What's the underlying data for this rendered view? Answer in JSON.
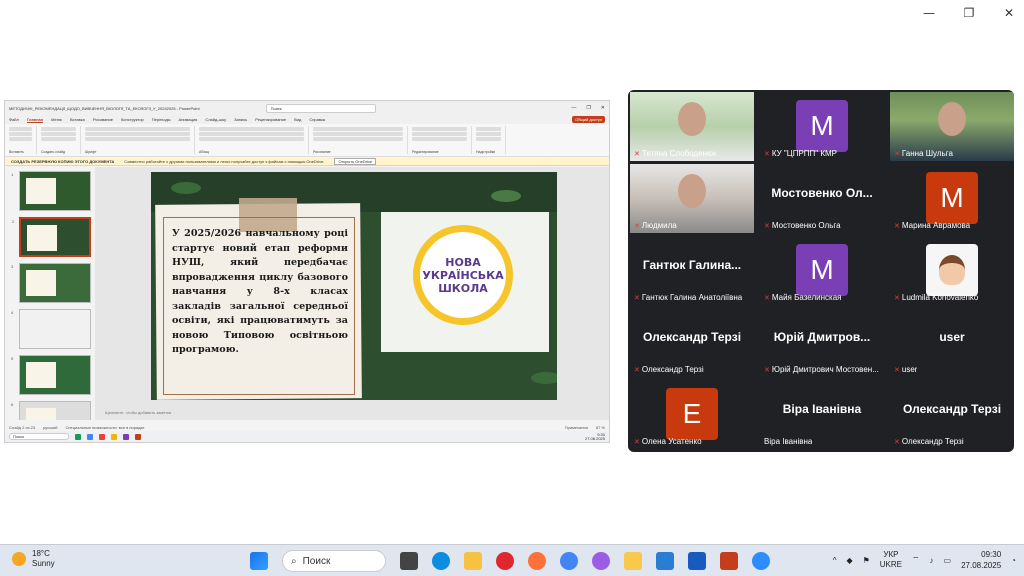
{
  "window": {
    "minimize": "—",
    "restore": "❐",
    "close": "✕"
  },
  "pp": {
    "title": "МЕТОДИЧНІ_РЕКОМЕНДАЦІЇ_ЩОДО_ВИВЧЕННЯ_ВІОЛОГІЇ_ТА_ЕКОЛОГІЇ_У_20242025 - PowerPoint",
    "search": "Поиск",
    "menu": [
      "Файл",
      "Главная",
      "Меню",
      "Вставка",
      "Рисование",
      "Конструктор",
      "Переходы",
      "Анимация",
      "Слайд-шоу",
      "Запись",
      "Рецензирование",
      "Вид",
      "Справка"
    ],
    "share_label": "Общий доступ",
    "ribbon_groups": [
      "Вставить",
      "Создать слайд",
      "Шрифт",
      "Абзац",
      "Рисование",
      "Редактирование",
      "Надстройки"
    ],
    "notice_bold": "СОЗДАТЬ РЕЗЕРВНУЮ КОПИЮ ЭТОГО ДОКУМЕНТА",
    "notice_text": "Совместно работайте с другими пользователями и легко получайте доступ к файлам с помощью OneDrive.",
    "notice_btn": "Открыть OneDrive",
    "slide_numbers": [
      "1",
      "2",
      "3",
      "4",
      "5",
      "6"
    ],
    "slide_text": "У 2025/2026 навчальному році стартує новий етап реформи НУШ, який передбачає впровадження циклу базового навчання у 8-х класах закладів загальної середньої освіти, які працюватимуть за новою Типовою освітньою програмою.",
    "logo_line1": "НОВА",
    "logo_line2": "УКРАЇНСЬКА",
    "logo_line3": "ШКОЛА",
    "notes": "Щелкните, чтобы добавить заметки",
    "status_left": "Слайд 2 из 23",
    "status_lang": "русский",
    "status_access": "Специальные возможности: все в порядке",
    "status_notes": "Примечания",
    "status_zoom": "87 %",
    "inner_search": "Поиск",
    "inner_time": "9:30",
    "inner_date": "27.08.2025"
  },
  "gallery": {
    "tiles": [
      {
        "name": "Тетяна Слободенюк",
        "type": "photo",
        "speaking": true
      },
      {
        "name": "КУ \"ЦПРПП\" КМР",
        "type": "avatar",
        "letter": "M",
        "color": "#7b3fb5"
      },
      {
        "name": "Ганна Шульга",
        "type": "photo"
      },
      {
        "name": "Людмила",
        "type": "photo"
      },
      {
        "name": "Мостовенко Ольга",
        "type": "text",
        "big": "Мостовенко Ол..."
      },
      {
        "name": "Марина Аврамова",
        "type": "avatar",
        "letter": "M",
        "color": "#c8390d"
      },
      {
        "name": "Гантюк Галина Анатоліївна",
        "type": "text",
        "big": "Гантюк Галина..."
      },
      {
        "name": "Майя Базелинская",
        "type": "avatar",
        "letter": "M",
        "color": "#7b3fb5"
      },
      {
        "name": "Ludmila Konovalenko",
        "type": "cartoon"
      },
      {
        "name": "Олександр Терзі",
        "type": "text",
        "big": "Олександр Терзі"
      },
      {
        "name": "Юрій Дмитрович Мостовен...",
        "type": "text",
        "big": "Юрій Дмитров..."
      },
      {
        "name": "user",
        "type": "text",
        "big": "user"
      },
      {
        "name": "Олена Усатенко",
        "type": "avatar",
        "letter": "E",
        "color": "#c8390d"
      },
      {
        "name": "Віра Іванівна",
        "type": "text",
        "big": "Віра Іванівна",
        "nomic": true
      },
      {
        "name": "Олександр Терзі",
        "type": "text",
        "big": "Олександр Терзі"
      }
    ]
  },
  "taskbar": {
    "temp": "18°C",
    "weather": "Sunny",
    "search": "Поиск",
    "lang1": "УКР",
    "lang2": "UKRE",
    "time": "09:30",
    "date": "27.08.2025"
  }
}
